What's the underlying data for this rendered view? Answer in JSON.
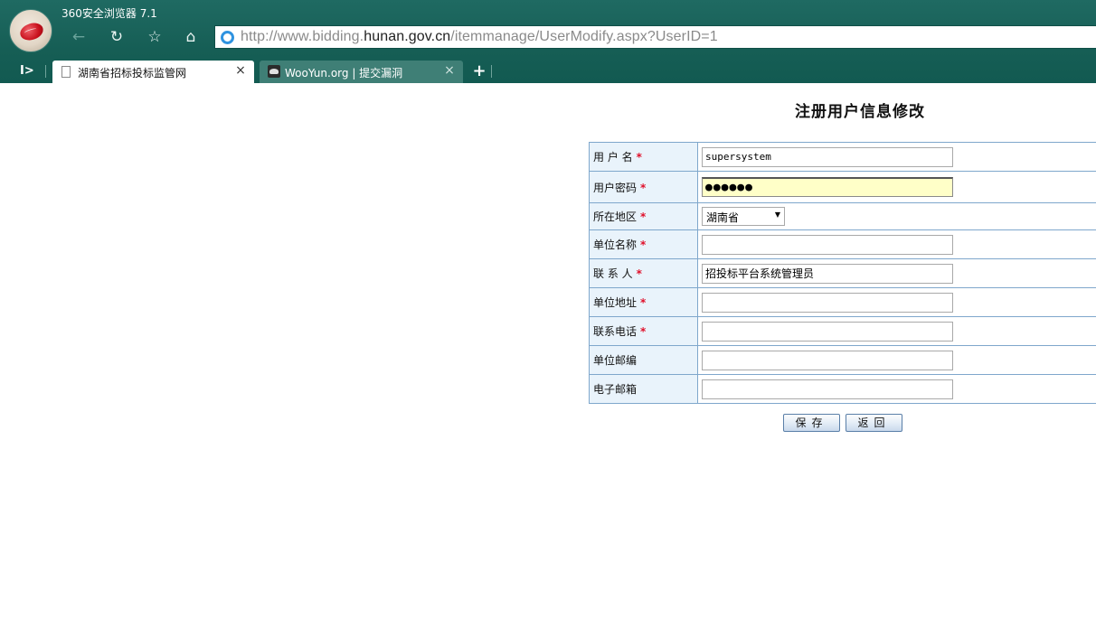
{
  "browser": {
    "app_title": "360安全浏览器 7.1",
    "address": {
      "prefix": "http://www.bidding.",
      "host": "hunan.gov.cn",
      "path": "/itemmanage/UserModify.aspx?UserID=1"
    },
    "nav_icons": {
      "back": "←",
      "refresh": "↻",
      "favorite": "☆",
      "home": "⌂"
    },
    "sidebar_toggle": "I>",
    "tabs": [
      {
        "label": "湖南省招标投标监管网",
        "close": "×",
        "active": true
      },
      {
        "label": "WooYun.org | 提交漏洞",
        "close": "×",
        "active": false
      }
    ],
    "new_tab": "+"
  },
  "form": {
    "title": "注册用户信息修改",
    "required_mark": "*",
    "fields": [
      {
        "label": "用 户 名",
        "required": true,
        "type": "text",
        "value": "supersystem"
      },
      {
        "label": "用户密码",
        "required": true,
        "type": "password",
        "value": "●●●●●●"
      },
      {
        "label": "所在地区",
        "required": true,
        "type": "select",
        "value": "湖南省"
      },
      {
        "label": "单位名称",
        "required": true,
        "type": "text",
        "value": ""
      },
      {
        "label": "联 系 人",
        "required": true,
        "type": "text",
        "value": "招投标平台系统管理员"
      },
      {
        "label": "单位地址",
        "required": true,
        "type": "text",
        "value": ""
      },
      {
        "label": "联系电话",
        "required": true,
        "type": "text",
        "value": ""
      },
      {
        "label": "单位邮编",
        "required": false,
        "type": "text",
        "value": ""
      },
      {
        "label": "电子邮箱",
        "required": false,
        "type": "text",
        "value": ""
      }
    ],
    "buttons": {
      "save": "保存",
      "back": "返回"
    }
  }
}
